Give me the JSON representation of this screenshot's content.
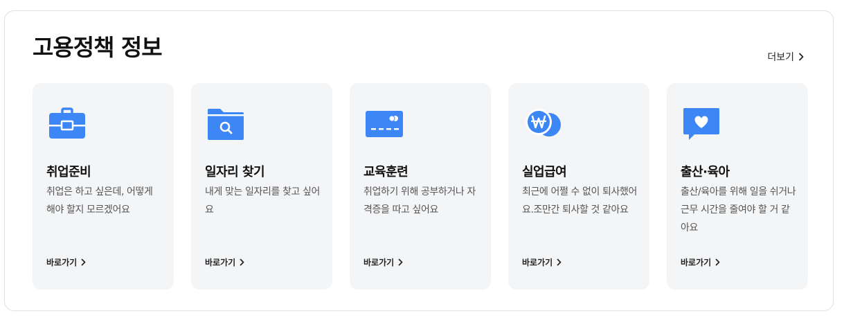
{
  "section": {
    "title": "고용정책 정보",
    "more_label": "더보기"
  },
  "colors": {
    "accent": "#3d86f5",
    "card_bg": "#f4f5f7",
    "border": "#dcdfe4"
  },
  "cards": [
    {
      "title": "취업준비",
      "desc": "취업은 하고 싶은데, 어떻게 해야 할지 모르겠어요",
      "link": "바로가기",
      "icon": "briefcase-icon"
    },
    {
      "title": "일자리 찾기",
      "desc": "내게 맞는 일자리를 찾고 싶어요",
      "link": "바로가기",
      "icon": "folder-search-icon"
    },
    {
      "title": "교육훈련",
      "desc": "취업하기 위해 공부하거나 자격증을 따고 싶어요",
      "link": "바로가기",
      "icon": "credit-card-icon"
    },
    {
      "title": "실업급여",
      "desc": "최근에 어쩔 수 없이 퇴사했어요.조만간 퇴사할 것 같아요",
      "link": "바로가기",
      "icon": "won-coin-icon"
    },
    {
      "title": "출산·육아",
      "desc": "출산/육아를 위해 일을 쉬거나 근무 시간을 줄여야 할 거 같아요",
      "link": "바로가기",
      "icon": "heart-chat-icon"
    }
  ]
}
